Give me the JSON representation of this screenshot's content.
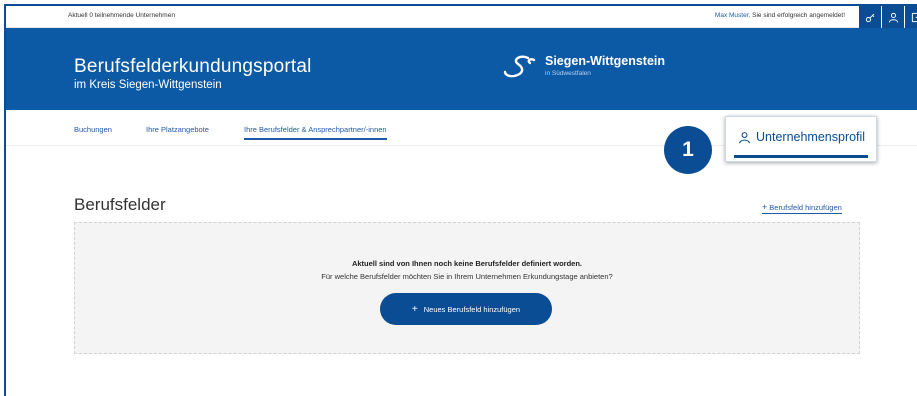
{
  "topbar": {
    "left_text": "Aktuell 0 teilnehmende Unternehmen",
    "user_name": "Max Muster,",
    "login_text": " Sie sind erfolgreich angemeldet!",
    "icons": [
      "key-icon",
      "user-icon",
      "logout-icon"
    ]
  },
  "header": {
    "title": "Berufsfelderkundungsportal",
    "subtitle": "im Kreis Siegen-Wittgenstein",
    "logo_name": "Siegen-Wittgenstein",
    "logo_sub": "in Südwestfalen"
  },
  "nav": {
    "tabs": [
      {
        "label": "Buchungen"
      },
      {
        "label": "Ihre Platzangebote"
      },
      {
        "label": "Ihre Berufsfelder & Ansprechpartner/-innen"
      }
    ]
  },
  "callout": {
    "number": "1",
    "label": "Unternehmensprofil"
  },
  "content": {
    "section_title": "Berufsfelder",
    "add_link": "Berufsfeld hinzufügen",
    "empty_line1": "Aktuell sind von Ihnen noch keine Berufsfelder definiert worden.",
    "empty_line2": "Für welche Berufsfelder möchten Sie in Ihrem Unternehmen Erkundungstage anbieten?",
    "new_button": "Neues Berufsfeld hinzufügen"
  },
  "colors": {
    "brand_blue": "#0c5aa6",
    "dark_blue": "#0a4d95",
    "link_blue": "#1f5aa8"
  }
}
